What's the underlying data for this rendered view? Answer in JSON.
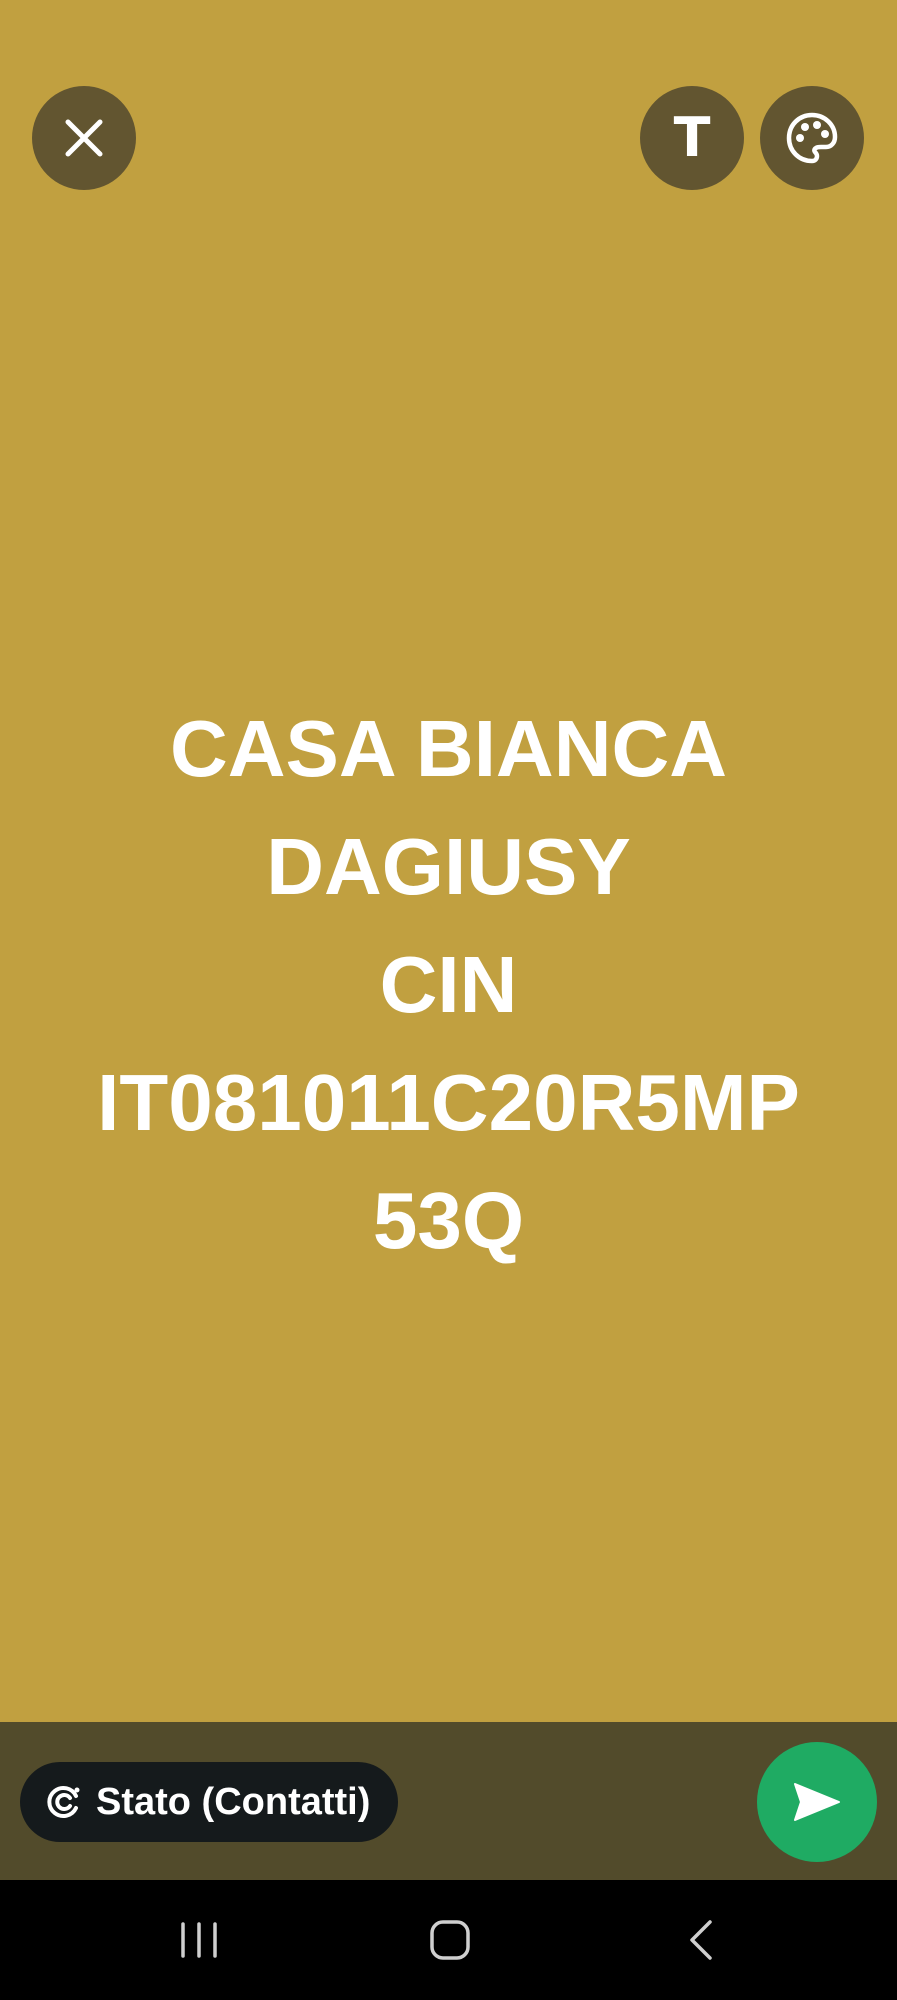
{
  "status_text": {
    "lines": [
      "CASA BIANCA",
      "DAGIUSY",
      "CIN",
      "IT081011C20R5MP",
      "53Q"
    ]
  },
  "toolbar": {
    "close_icon": "close-icon",
    "text_glyph": "T",
    "palette_icon": "palette-icon"
  },
  "footer": {
    "audience_label": "Stato (Contatti)",
    "audience_icon": "status-ring-icon",
    "send_icon": "send-icon"
  },
  "nav": {
    "recents_icon": "recents-icon",
    "home_icon": "home-icon",
    "back_icon": "back-icon"
  },
  "colors": {
    "background": "#c1a040",
    "overlay_button": "#625530",
    "bottom_bar": "#524b2b",
    "pill": "#151a1c",
    "send": "#1fab63",
    "text": "#ffffff"
  }
}
